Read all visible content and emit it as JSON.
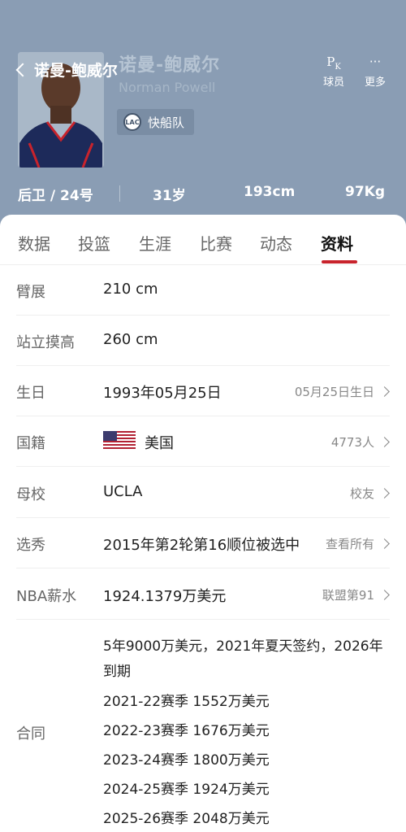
{
  "header": {
    "back_title": "诺曼-鲍威尔",
    "name_cn": "诺曼-鲍威尔",
    "name_en": "Norman Powell",
    "team": "快船队",
    "team_logo_text": "LAC",
    "actions": [
      {
        "label": "球员",
        "icon_text": "P"
      },
      {
        "label": "更多",
        "icon_text": "···"
      }
    ]
  },
  "stats": {
    "position_number": "后卫 / 24号",
    "age": "31岁",
    "height": "193cm",
    "weight": "97Kg"
  },
  "tabs": [
    {
      "label": "数据"
    },
    {
      "label": "投篮"
    },
    {
      "label": "生涯"
    },
    {
      "label": "比赛"
    },
    {
      "label": "动态"
    },
    {
      "label": "资料"
    }
  ],
  "active_tab": "资料",
  "profile": {
    "wingspan": {
      "label": "臂展",
      "value": "210 cm"
    },
    "standing_reach": {
      "label": "站立摸高",
      "value": "260 cm"
    },
    "birthday": {
      "label": "生日",
      "value": "1993年05月25日",
      "right": "05月25日生日"
    },
    "nationality": {
      "label": "国籍",
      "value": "美国",
      "right": "4773人"
    },
    "college": {
      "label": "母校",
      "value": "UCLA",
      "right": "校友"
    },
    "draft": {
      "label": "选秀",
      "value": "2015年第2轮第16顺位被选中",
      "right": "查看所有"
    },
    "salary": {
      "label": "NBA薪水",
      "value": "1924.1379万美元",
      "right": "联盟第91"
    },
    "contract": {
      "label": "合同",
      "summary": "5年9000万美元，2021年夏天签约，2026年到期",
      "seasons": [
        "2021-22赛季 1552万美元",
        "2022-23赛季 1676万美元",
        "2023-24赛季 1800万美元",
        "2024-25赛季 1924万美元",
        "2025-26赛季 2048万美元"
      ]
    }
  },
  "colors": {
    "header_bg": "#8a9db4",
    "accent_red": "#c8232c"
  }
}
